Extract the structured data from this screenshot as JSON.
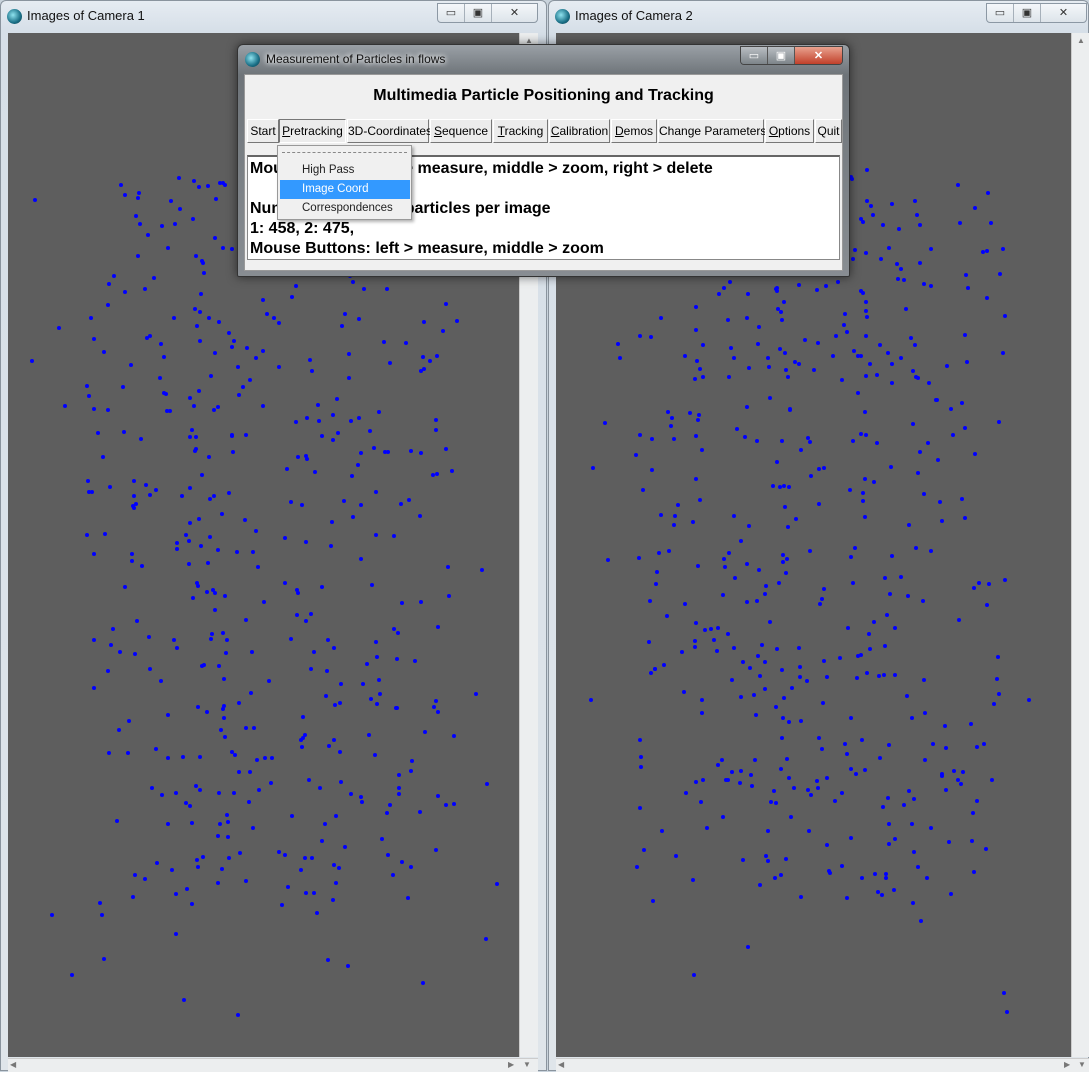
{
  "camera1": {
    "title": "Images of Camera 1",
    "particle_count": 458
  },
  "camera2": {
    "title": "Images of Camera 2",
    "particle_count": 475
  },
  "window_controls": {
    "minimize": "▭",
    "maximize": "▣",
    "close": "✕"
  },
  "dialog": {
    "title": "Measurement of Particles in flows",
    "heading": "Multimedia Particle Positioning and Tracking",
    "buttons": [
      {
        "label": "Start",
        "underline": ""
      },
      {
        "label": "Pretracking",
        "underline": "P"
      },
      {
        "label": "3D-Coordinates",
        "underline": ""
      },
      {
        "label": "Sequence",
        "underline": "S"
      },
      {
        "label": "Tracking",
        "underline": "T"
      },
      {
        "label": "Calibration",
        "underline": "C"
      },
      {
        "label": "Demos",
        "underline": "D"
      },
      {
        "label": "Change Parameters",
        "underline": "P"
      },
      {
        "label": "Options",
        "underline": "O"
      },
      {
        "label": "Quit",
        "underline": ""
      }
    ],
    "output_lines": [
      "Mouse Buttons: left > measure, middle > zoom, right > delete",
      "",
      "Number of detected particles per image",
      "1: 458,  2: 475,",
      "Mouse Buttons: left > measure, middle > zoom"
    ]
  },
  "pretracking_menu": {
    "items": [
      "High Pass",
      "Image Coord",
      "Correspondences"
    ],
    "selected": "Image Coord"
  },
  "colors": {
    "particle": "#0000ff",
    "background": "#5e5e5e",
    "menu_highlight": "#3399ff"
  }
}
